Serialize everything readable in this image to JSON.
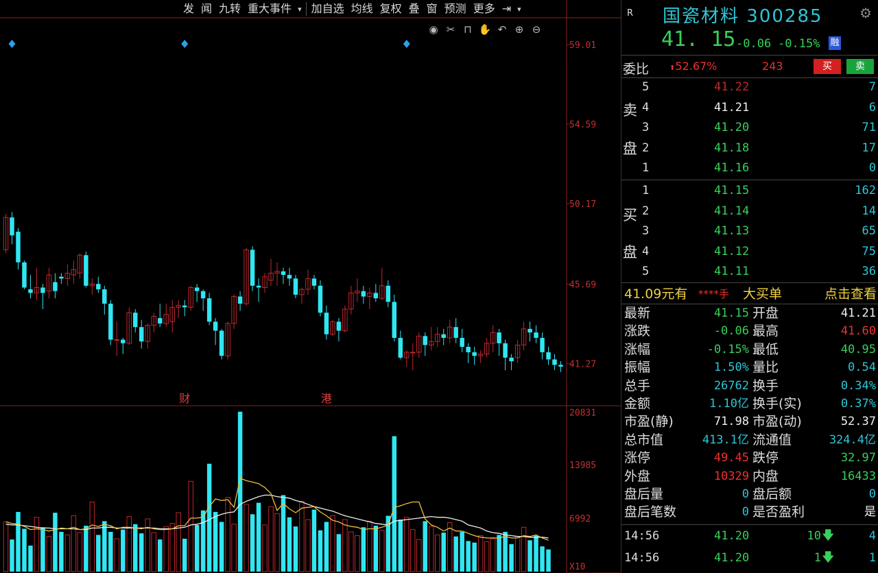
{
  "toolbar": {
    "items": [
      "发",
      "闻",
      "九转",
      "重大事件",
      "加自选",
      "均线",
      "复权",
      "叠",
      "窗",
      "预测",
      "更多"
    ],
    "dropdown_arrow": "▾",
    "collapse_icon": "⇥"
  },
  "chart_icons": [
    "eye-icon",
    "scissors-icon",
    "lock-icon",
    "hand-icon",
    "undo-icon",
    "zoom-in-icon",
    "zoom-out-icon"
  ],
  "colors": {
    "up": "#c0282e",
    "down": "#30e6f2",
    "ma5": "#f0f0f0",
    "ma10": "#f0c040",
    "green": "#37d05a",
    "cyan": "#2fc6d6",
    "red": "#f02f2f"
  },
  "price_axis": {
    "labels": [
      "59.01",
      "54.59",
      "50.17",
      "45.69",
      "41.27"
    ]
  },
  "volume_axis": {
    "labels": [
      "20831",
      "13985",
      "6992",
      "X10"
    ]
  },
  "event_markers": [
    "财",
    "港"
  ],
  "chart_data": {
    "type": "candlestick",
    "price_range": [
      39.0,
      60.5
    ],
    "candles": [
      {
        "o": 47.6,
        "c": 49.4,
        "h": 49.6,
        "l": 47.4
      },
      {
        "o": 49.4,
        "c": 48.4,
        "h": 49.7,
        "l": 47.9
      },
      {
        "o": 48.6,
        "c": 46.9,
        "h": 48.8,
        "l": 46.5
      },
      {
        "o": 46.9,
        "c": 45.5,
        "h": 47.0,
        "l": 45.4
      },
      {
        "o": 45.4,
        "c": 45.2,
        "h": 46.2,
        "l": 44.9
      },
      {
        "o": 45.2,
        "c": 45.5,
        "h": 46.6,
        "l": 44.8
      },
      {
        "o": 45.5,
        "c": 45.2,
        "h": 45.7,
        "l": 44.3
      },
      {
        "o": 45.3,
        "c": 46.2,
        "h": 46.6,
        "l": 44.9
      },
      {
        "o": 45.8,
        "c": 45.3,
        "h": 46.3,
        "l": 44.9
      },
      {
        "o": 46.1,
        "c": 46.0,
        "h": 46.3,
        "l": 45.7
      },
      {
        "o": 46.0,
        "c": 46.3,
        "h": 46.8,
        "l": 45.6
      },
      {
        "o": 46.2,
        "c": 46.5,
        "h": 47.0,
        "l": 45.7
      },
      {
        "o": 46.3,
        "c": 47.3,
        "h": 47.4,
        "l": 46.0
      },
      {
        "o": 47.3,
        "c": 45.6,
        "h": 47.5,
        "l": 45.5
      },
      {
        "o": 45.6,
        "c": 45.7,
        "h": 46.0,
        "l": 45.1
      },
      {
        "o": 45.7,
        "c": 45.4,
        "h": 46.1,
        "l": 45.2
      },
      {
        "o": 45.4,
        "c": 44.6,
        "h": 45.6,
        "l": 44.0
      },
      {
        "o": 44.6,
        "c": 42.6,
        "h": 44.8,
        "l": 42.3
      },
      {
        "o": 42.6,
        "c": 42.6,
        "h": 43.6,
        "l": 41.7
      },
      {
        "o": 42.6,
        "c": 42.4,
        "h": 42.7,
        "l": 41.8
      },
      {
        "o": 42.4,
        "c": 44.1,
        "h": 44.4,
        "l": 42.3
      },
      {
        "o": 44.1,
        "c": 43.3,
        "h": 44.3,
        "l": 43.0
      },
      {
        "o": 43.3,
        "c": 42.5,
        "h": 43.7,
        "l": 42.1
      },
      {
        "o": 42.5,
        "c": 43.4,
        "h": 43.5,
        "l": 42.1
      },
      {
        "o": 43.4,
        "c": 43.9,
        "h": 44.1,
        "l": 43.0
      },
      {
        "o": 43.8,
        "c": 43.5,
        "h": 44.6,
        "l": 43.3
      },
      {
        "o": 43.5,
        "c": 44.0,
        "h": 44.6,
        "l": 43.3
      },
      {
        "o": 43.6,
        "c": 44.4,
        "h": 44.8,
        "l": 43.0
      },
      {
        "o": 44.4,
        "c": 44.5,
        "h": 44.8,
        "l": 43.8
      },
      {
        "o": 44.5,
        "c": 44.4,
        "h": 44.8,
        "l": 43.9
      },
      {
        "o": 44.4,
        "c": 45.5,
        "h": 45.6,
        "l": 44.2
      },
      {
        "o": 45.5,
        "c": 45.3,
        "h": 45.7,
        "l": 44.7
      },
      {
        "o": 45.3,
        "c": 44.9,
        "h": 45.4,
        "l": 44.2
      },
      {
        "o": 44.9,
        "c": 43.6,
        "h": 45.2,
        "l": 43.4
      },
      {
        "o": 43.6,
        "c": 43.1,
        "h": 43.8,
        "l": 42.3
      },
      {
        "o": 43.1,
        "c": 41.7,
        "h": 43.2,
        "l": 41.5
      },
      {
        "o": 41.7,
        "c": 43.5,
        "h": 43.6,
        "l": 41.5
      },
      {
        "o": 43.5,
        "c": 45.0,
        "h": 45.1,
        "l": 43.2
      },
      {
        "o": 45.0,
        "c": 44.6,
        "h": 45.3,
        "l": 44.2
      },
      {
        "o": 44.6,
        "c": 47.6,
        "h": 47.7,
        "l": 44.5
      },
      {
        "o": 47.6,
        "c": 45.6,
        "h": 47.8,
        "l": 45.3
      },
      {
        "o": 45.6,
        "c": 45.5,
        "h": 46.0,
        "l": 44.7
      },
      {
        "o": 45.5,
        "c": 46.1,
        "h": 46.3,
        "l": 45.2
      },
      {
        "o": 45.9,
        "c": 46.3,
        "h": 47.1,
        "l": 45.6
      },
      {
        "o": 46.3,
        "c": 46.4,
        "h": 46.9,
        "l": 45.6
      },
      {
        "o": 46.4,
        "c": 46.2,
        "h": 46.6,
        "l": 45.7
      },
      {
        "o": 46.2,
        "c": 46.0,
        "h": 46.6,
        "l": 45.6
      },
      {
        "o": 46.0,
        "c": 45.1,
        "h": 46.2,
        "l": 44.9
      },
      {
        "o": 45.1,
        "c": 45.4,
        "h": 45.5,
        "l": 44.6
      },
      {
        "o": 45.4,
        "c": 46.0,
        "h": 46.5,
        "l": 45.1
      },
      {
        "o": 46.0,
        "c": 45.6,
        "h": 46.2,
        "l": 45.4
      },
      {
        "o": 45.6,
        "c": 44.1,
        "h": 45.9,
        "l": 43.9
      },
      {
        "o": 44.1,
        "c": 42.9,
        "h": 44.5,
        "l": 42.6
      },
      {
        "o": 42.9,
        "c": 43.6,
        "h": 43.7,
        "l": 42.8
      },
      {
        "o": 43.6,
        "c": 43.1,
        "h": 43.8,
        "l": 42.5
      },
      {
        "o": 43.1,
        "c": 44.3,
        "h": 44.5,
        "l": 43.0
      },
      {
        "o": 44.3,
        "c": 45.2,
        "h": 45.6,
        "l": 44.0
      },
      {
        "o": 45.2,
        "c": 45.3,
        "h": 46.0,
        "l": 44.7
      },
      {
        "o": 45.3,
        "c": 45.0,
        "h": 45.6,
        "l": 44.6
      },
      {
        "o": 45.0,
        "c": 45.2,
        "h": 45.5,
        "l": 44.3
      },
      {
        "o": 45.2,
        "c": 44.9,
        "h": 45.7,
        "l": 44.7
      },
      {
        "o": 44.9,
        "c": 45.6,
        "h": 46.6,
        "l": 44.8
      },
      {
        "o": 45.6,
        "c": 44.7,
        "h": 45.9,
        "l": 44.4
      },
      {
        "o": 44.7,
        "c": 42.7,
        "h": 45.1,
        "l": 42.5
      },
      {
        "o": 42.7,
        "c": 41.6,
        "h": 43.1,
        "l": 41.5
      },
      {
        "o": 41.6,
        "c": 41.9,
        "h": 42.0,
        "l": 41.1
      },
      {
        "o": 41.9,
        "c": 41.9,
        "h": 42.4,
        "l": 40.9
      },
      {
        "o": 41.9,
        "c": 42.8,
        "h": 43.0,
        "l": 41.6
      },
      {
        "o": 42.8,
        "c": 42.3,
        "h": 43.0,
        "l": 41.7
      },
      {
        "o": 42.3,
        "c": 42.5,
        "h": 43.3,
        "l": 42.0
      },
      {
        "o": 42.5,
        "c": 42.9,
        "h": 43.3,
        "l": 42.2
      },
      {
        "o": 42.9,
        "c": 42.7,
        "h": 43.2,
        "l": 42.3
      },
      {
        "o": 42.7,
        "c": 43.3,
        "h": 43.7,
        "l": 42.4
      },
      {
        "o": 43.3,
        "c": 42.7,
        "h": 43.8,
        "l": 42.4
      },
      {
        "o": 42.7,
        "c": 42.2,
        "h": 43.2,
        "l": 41.9
      },
      {
        "o": 42.2,
        "c": 41.9,
        "h": 42.4,
        "l": 41.3
      },
      {
        "o": 41.9,
        "c": 41.7,
        "h": 42.2,
        "l": 41.2
      },
      {
        "o": 41.7,
        "c": 41.8,
        "h": 42.0,
        "l": 41.3
      },
      {
        "o": 41.8,
        "c": 42.4,
        "h": 42.7,
        "l": 41.6
      },
      {
        "o": 42.4,
        "c": 43.0,
        "h": 43.4,
        "l": 41.9
      },
      {
        "o": 43.0,
        "c": 42.4,
        "h": 43.2,
        "l": 41.7
      },
      {
        "o": 42.4,
        "c": 41.6,
        "h": 42.6,
        "l": 40.9
      },
      {
        "o": 41.6,
        "c": 41.4,
        "h": 41.8,
        "l": 40.9
      },
      {
        "o": 41.6,
        "c": 42.3,
        "h": 42.6,
        "l": 41.3
      },
      {
        "o": 42.3,
        "c": 43.2,
        "h": 43.6,
        "l": 42.0
      },
      {
        "o": 43.2,
        "c": 43.0,
        "h": 43.6,
        "l": 42.5
      },
      {
        "o": 43.0,
        "c": 42.7,
        "h": 43.4,
        "l": 42.4
      },
      {
        "o": 42.7,
        "c": 41.9,
        "h": 43.0,
        "l": 41.5
      },
      {
        "o": 41.9,
        "c": 41.5,
        "h": 42.2,
        "l": 41.2
      },
      {
        "o": 41.5,
        "c": 41.2,
        "h": 41.8,
        "l": 40.9
      },
      {
        "o": 41.2,
        "c": 41.1,
        "h": 41.4,
        "l": 40.8
      }
    ],
    "volume_range": [
      0,
      21500
    ],
    "volumes": [
      6500,
      4200,
      7800,
      5600,
      3400,
      7100,
      5800,
      4600,
      7700,
      5200,
      4800,
      7300,
      5100,
      6000,
      9100,
      4800,
      6600,
      5200,
      4300,
      5500,
      7200,
      6200,
      5000,
      6900,
      5100,
      4200,
      5900,
      6300,
      7700,
      4300,
      11800,
      6100,
      8000,
      14100,
      7800,
      6500,
      9700,
      6200,
      20900,
      8800,
      7500,
      9000,
      6100,
      8500,
      7600,
      10000,
      7100,
      5900,
      9200,
      6800,
      8100,
      5400,
      6500,
      7300,
      4900,
      6800,
      5200,
      4700,
      5800,
      6600,
      6000,
      5400,
      7300,
      17700,
      6800,
      7100,
      5500,
      4200,
      6600,
      5900,
      4800,
      5100,
      6400,
      4600,
      5200,
      4000,
      3800,
      4700,
      3900,
      4300,
      4800,
      5200,
      3600,
      4600,
      5800,
      4100,
      4700,
      3300,
      2900
    ],
    "ma5": [
      6500,
      6300,
      6200,
      5900,
      5500,
      5600,
      5500,
      5300,
      5500,
      5700,
      5600,
      5800,
      5500,
      5600,
      6100,
      5900,
      6200,
      6000,
      5600,
      5800,
      5800,
      5700,
      5600,
      5800,
      5600,
      5500,
      5500,
      5600,
      6000,
      6000,
      7000,
      7000,
      7100,
      8500,
      9500,
      9300,
      9400,
      8400,
      12200,
      11900,
      11700,
      11500,
      11000,
      10200,
      8000,
      8900,
      8200,
      7700,
      8300,
      8400,
      8500,
      7800,
      7300,
      6700,
      6500,
      6100,
      5900,
      5800,
      5500,
      5600,
      5600,
      5800,
      6100,
      8400,
      8600,
      8900,
      9100,
      9100,
      6900,
      6100,
      5800,
      5300,
      5700,
      5300,
      5300,
      5000,
      4700,
      4500,
      4400,
      4400,
      4400,
      4600,
      4400,
      4400,
      4700,
      4600,
      4800,
      4400,
      4100
    ],
    "ma10": [
      6200,
      6100,
      6100,
      6000,
      5900,
      5800,
      5700,
      5700,
      5600,
      5600,
      5600,
      5600,
      5500,
      5500,
      5700,
      5700,
      5800,
      5800,
      5700,
      5700,
      5700,
      5700,
      5700,
      5700,
      5700,
      5600,
      5600,
      5600,
      5700,
      5800,
      6100,
      6200,
      6400,
      6800,
      7200,
      7500,
      7700,
      7800,
      8800,
      9200,
      9500,
      9800,
      10000,
      10000,
      9800,
      9700,
      9600,
      9300,
      9100,
      8800,
      8500,
      8300,
      8100,
      7900,
      7600,
      7300,
      7100,
      6900,
      6700,
      6500,
      6300,
      6200,
      6100,
      6600,
      6700,
      6800,
      6900,
      7000,
      7100,
      7200,
      7100,
      7100,
      7000,
      6800,
      6600,
      6100,
      5900,
      5700,
      5300,
      5100,
      5000,
      4800,
      4700,
      4600,
      4600,
      4500,
      4500,
      4500,
      4400
    ]
  },
  "stock": {
    "tag": "R",
    "name": "国瓷材料",
    "code": "300285",
    "price": "41. 15",
    "change": "-0.06",
    "change_pct": "-0.15%",
    "badge": "融"
  },
  "webi": {
    "label": "委比",
    "pct": "52.67%",
    "diff": "243",
    "buy_btn": "买",
    "sell_btn": "卖"
  },
  "orderbook": {
    "sell_side_label": [
      "卖",
      "盘"
    ],
    "buy_side_label": [
      "买",
      "盘"
    ],
    "sell": [
      {
        "lvl": "5",
        "price": "41.22",
        "vol": "7",
        "color": "#c0282e"
      },
      {
        "lvl": "4",
        "price": "41.21",
        "vol": "6",
        "color": "#f0f0f0"
      },
      {
        "lvl": "3",
        "price": "41.20",
        "vol": "71",
        "color": "#37d05a"
      },
      {
        "lvl": "2",
        "price": "41.18",
        "vol": "17",
        "color": "#37d05a"
      },
      {
        "lvl": "1",
        "price": "41.16",
        "vol": "0",
        "color": "#37d05a"
      }
    ],
    "buy": [
      {
        "lvl": "1",
        "price": "41.15",
        "vol": "162",
        "color": "#37d05a"
      },
      {
        "lvl": "2",
        "price": "41.14",
        "vol": "14",
        "color": "#37d05a"
      },
      {
        "lvl": "3",
        "price": "41.13",
        "vol": "65",
        "color": "#37d05a"
      },
      {
        "lvl": "4",
        "price": "41.12",
        "vol": "75",
        "color": "#37d05a"
      },
      {
        "lvl": "5",
        "price": "41.11",
        "vol": "36",
        "color": "#37d05a"
      }
    ]
  },
  "bigorder": {
    "price": "41.09元有",
    "hands": "****手",
    "label": "大买单",
    "action": "点击查看"
  },
  "stats": [
    {
      "l": "最新",
      "lv": "41.15",
      "lc": "#37d05a",
      "r": "开盘",
      "rv": "41.21",
      "rc": "#f0f0f0"
    },
    {
      "l": "涨跌",
      "lv": "-0.06",
      "lc": "#37d05a",
      "r": "最高",
      "rv": "41.60",
      "rc": "#f02f2f"
    },
    {
      "l": "涨幅",
      "lv": "-0.15%",
      "lc": "#37d05a",
      "r": "最低",
      "rv": "40.95",
      "rc": "#37d05a"
    },
    {
      "l": "振幅",
      "lv": "1.50%",
      "lc": "#2fc6d6",
      "r": "量比",
      "rv": "0.54",
      "rc": "#2fc6d6"
    },
    {
      "l": "总手",
      "lv": "26762",
      "lc": "#2fc6d6",
      "r": "换手",
      "rv": "0.34%",
      "rc": "#2fc6d6"
    },
    {
      "l": "金额",
      "lv": "1.10亿",
      "lc": "#2fc6d6",
      "r": "换手(实)",
      "rv": "0.37%",
      "rc": "#2fc6d6"
    },
    {
      "l": "市盈(静)",
      "lv": "71.98",
      "lc": "#f0f0f0",
      "r": "市盈(动)",
      "rv": "52.37",
      "rc": "#f0f0f0"
    },
    {
      "l": "总市值",
      "lv": "413.1亿",
      "lc": "#2fc6d6",
      "r": "流通值",
      "rv": "324.4亿",
      "rc": "#2fc6d6"
    },
    {
      "l": "涨停",
      "lv": "49.45",
      "lc": "#f02f2f",
      "r": "跌停",
      "rv": "32.97",
      "rc": "#37d05a"
    },
    {
      "l": "外盘",
      "lv": "10329",
      "lc": "#f02f2f",
      "r": "内盘",
      "rv": "16433",
      "rc": "#37d05a"
    },
    {
      "l": "盘后量",
      "lv": "0",
      "lc": "#2fc6d6",
      "r": "盘后额",
      "rv": "0",
      "rc": "#2fc6d6"
    },
    {
      "l": "盘后笔数",
      "lv": "0",
      "lc": "#2fc6d6",
      "r": "是否盈利",
      "rv": "是",
      "rc": "#f0f0f0"
    }
  ],
  "ticks": [
    {
      "time": "14:56",
      "price": "41.20",
      "vol": "10",
      "arrow": "🡇",
      "n": "4"
    },
    {
      "time": "14:56",
      "price": "41.20",
      "vol": "1",
      "arrow": "🡇",
      "n": "1"
    }
  ]
}
